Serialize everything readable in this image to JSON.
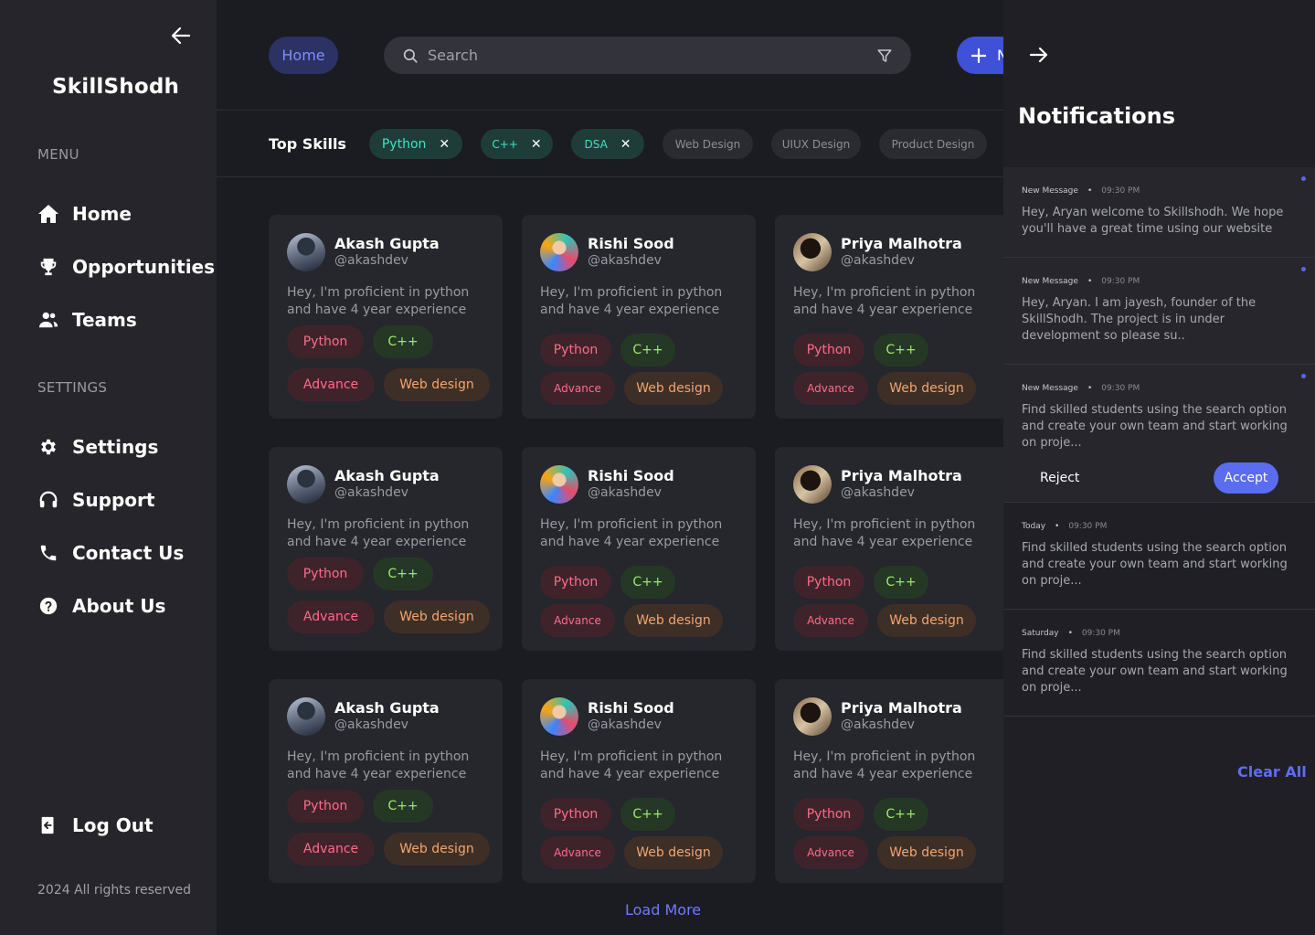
{
  "sidebar": {
    "brand": "SkillShodh",
    "menu_label": "MENU",
    "settings_label": "SETTINGS",
    "menu_items": [
      {
        "label": "Home",
        "icon": "home-icon"
      },
      {
        "label": "Opportunities",
        "icon": "trophy-icon"
      },
      {
        "label": "Teams",
        "icon": "users-icon"
      }
    ],
    "settings_items": [
      {
        "label": "Settings",
        "icon": "gear-icon"
      },
      {
        "label": "Support",
        "icon": "headset-icon"
      },
      {
        "label": "Contact Us",
        "icon": "phone-icon"
      },
      {
        "label": "About Us",
        "icon": "question-icon"
      }
    ],
    "logout": "Log Out",
    "copyright": "2024 All rights reserved"
  },
  "header": {
    "home": "Home",
    "search_placeholder": "Search",
    "new_button": "N"
  },
  "skills": {
    "title": "Top Skills",
    "active": [
      "Python",
      "C++",
      "DSA"
    ],
    "others": [
      "Web Design",
      "UIUX Design",
      "Product Design"
    ]
  },
  "cards": [
    {
      "name": "Akash Gupta",
      "handle": "@akashdev",
      "bio": "Hey, I'm proficient in python and have 4 year experience",
      "tags": [
        "Python",
        "C++",
        "Advance",
        "Web design"
      ]
    },
    {
      "name": "Rishi Sood",
      "handle": "@akashdev",
      "bio": "Hey, I'm proficient in python and have 4 year experience",
      "tags": [
        "Python",
        "C++",
        "Advance",
        "Web design"
      ]
    },
    {
      "name": "Priya Malhotra",
      "handle": "@akashdev",
      "bio": "Hey, I'm proficient in python and have 4 year experience",
      "tags": [
        "Python",
        "C++",
        "Advance",
        "Web design"
      ]
    }
  ],
  "load_more": "Load More",
  "notifications": {
    "title": "Notifications",
    "items": [
      {
        "label": "New Message",
        "time": "09:30 PM",
        "body": "Hey, Aryan welcome to Skillshodh. We hope you'll have a great time using our website",
        "unread": true
      },
      {
        "label": "New Message",
        "time": "09:30 PM",
        "body": "Hey, Aryan. I am jayesh, founder of the SkillShodh. The project is in under development so please su..",
        "unread": true
      },
      {
        "label": "New Message",
        "time": "09:30 PM",
        "body": "Find skilled students using the search option and create your own team and  start working on proje...",
        "unread": true
      },
      {
        "label": "Today",
        "time": "09:30 PM",
        "body": "Find skilled students using the search option and create your own team and  start working on proje...",
        "unread": false
      },
      {
        "label": "Saturday",
        "time": "09:30 PM",
        "body": "Find skilled students using the search option and create your own team and  start working on proje...",
        "unread": false
      }
    ],
    "reject": "Reject",
    "accept": "Accept",
    "clear_all": "Clear All"
  },
  "colors": {
    "accent": "#5a6cf0",
    "sidebar": "#25252b",
    "background": "#1b1b22"
  }
}
